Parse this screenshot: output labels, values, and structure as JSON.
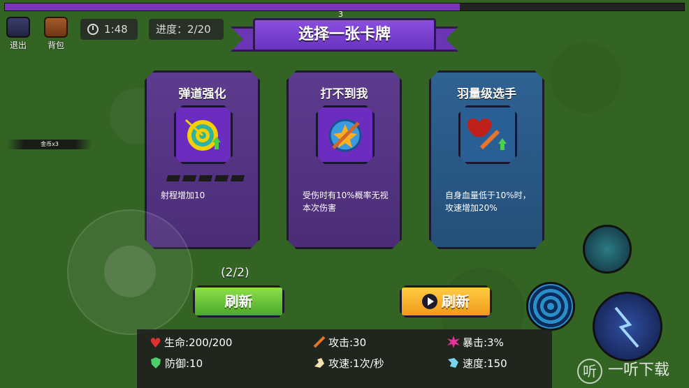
{
  "top": {
    "xp_fraction": 0.67,
    "level_label": "3",
    "exit_label": "退出",
    "bag_label": "背包",
    "timer": "1:48",
    "progress": "进度：2/20"
  },
  "banner": {
    "title": "选择一张卡牌"
  },
  "cards": [
    {
      "title": "弹道强化",
      "icon": "target-arrow-upgrade-icon",
      "desc": "射程增加10",
      "level_dots_total": 5,
      "level_dots_filled": 0,
      "theme": "purple"
    },
    {
      "title": "打不到我",
      "icon": "dodge-shield-icon",
      "desc": "受伤时有10%概率无视本次伤害",
      "theme": "purple"
    },
    {
      "title": "羽量级选手",
      "icon": "heart-sword-upgrade-icon",
      "desc": "自身血量低于10%时，攻速增加20%",
      "theme": "blue"
    }
  ],
  "refresh": {
    "counter": "(2/2)",
    "free_label": "刷新",
    "ad_label": "刷新"
  },
  "side": {
    "coin_tag": "金币x3"
  },
  "stats": {
    "hp": "生命:200/200",
    "attack": "攻击:30",
    "crit": "暴击:3%",
    "defense": "防御:10",
    "attack_speed": "攻速:1次/秒",
    "speed": "速度:150"
  },
  "watermark": {
    "mark": "听",
    "text": "一听下载"
  },
  "colors": {
    "card_purple": "#5d3b8e",
    "card_blue": "#2f6292",
    "refresh_green": "#6cc43a",
    "refresh_orange": "#f8b42c",
    "banner": "#7a42d0"
  }
}
